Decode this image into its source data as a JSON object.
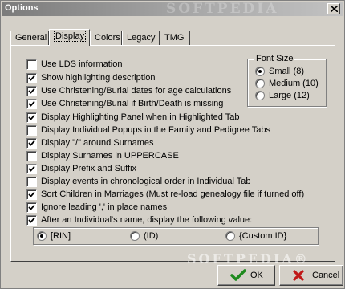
{
  "window": {
    "title": "Options",
    "watermark": "SOFTPEDIA",
    "watermark_bottom": "SOFTPEDIA®"
  },
  "tabs": [
    {
      "label": "General"
    },
    {
      "label": "Display"
    },
    {
      "label": "Colors"
    },
    {
      "label": "Legacy"
    },
    {
      "label": "TMG"
    }
  ],
  "active_tab": "Display",
  "options": [
    {
      "label": "Use LDS information",
      "checked": false
    },
    {
      "label": "Show highlighting description",
      "checked": true
    },
    {
      "label": "Use Christening/Burial dates for age calculations",
      "checked": true
    },
    {
      "label": "Use Christening/Burial if Birth/Death is missing",
      "checked": true
    },
    {
      "label": "Display Highlighting Panel when in Highlighted Tab",
      "checked": true
    },
    {
      "label": "Display Individual Popups in the Family and Pedigree Tabs",
      "checked": false
    },
    {
      "label": "Display \"/\" around Surnames",
      "checked": true
    },
    {
      "label": "Display Surnames in UPPERCASE",
      "checked": false
    },
    {
      "label": "Display Prefix and Suffix",
      "checked": true
    },
    {
      "label": "Display events in chronological order in Individual Tab",
      "checked": false
    },
    {
      "label": "Sort Children in Marriages (Must re-load genealogy file if turned off)",
      "checked": true
    },
    {
      "label": "Ignore leading ',' in place names",
      "checked": true
    }
  ],
  "font_size": {
    "title": "Font Size",
    "options": [
      "Small (8)",
      "Medium (10)",
      "Large (12)"
    ],
    "selected": "Small (8)"
  },
  "name_display": {
    "label": "After an Individual's name, display the following value:",
    "checked": true,
    "options": [
      "[RIN]",
      "(ID)",
      "{Custom ID}"
    ],
    "selected": "[RIN]"
  },
  "buttons": {
    "ok": "OK",
    "cancel": "Cancel"
  },
  "colors": {
    "ok_check": "#1e8a1e",
    "cancel_x": "#c01818"
  }
}
